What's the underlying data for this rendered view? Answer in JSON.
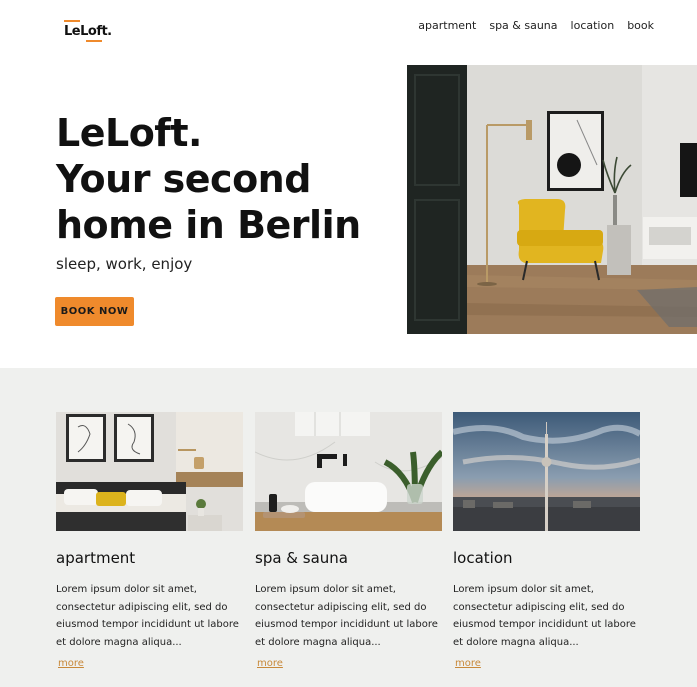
{
  "header": {
    "logo": "LeLoft.",
    "nav": [
      "apartment",
      "spa & sauna",
      "location",
      "book"
    ]
  },
  "hero": {
    "title_lines": [
      "LeLoft.",
      "Your second",
      "home in Berlin"
    ],
    "tagline": "sleep, work, enjoy",
    "cta": "BOOK NOW"
  },
  "cards": [
    {
      "title": "apartment",
      "text": "Lorem ipsum dolor sit amet, consectetur adipiscing elit, sed do eiusmod tempor incididunt ut labore et dolore magna aliqua...",
      "more": "more"
    },
    {
      "title": "spa & sauna",
      "text": "Lorem ipsum dolor sit amet, consectetur adipiscing elit, sed do eiusmod tempor incididunt ut labore et dolore magna aliqua...",
      "more": "more"
    },
    {
      "title": "location",
      "text": "Lorem ipsum dolor sit amet, consectetur adipiscing elit, sed do eiusmod tempor incididunt ut labore et dolore magna aliqua...",
      "more": "more"
    }
  ],
  "colors": {
    "accent": "#ef8a2c",
    "section_bg": "#eff0ee",
    "link": "#c8893a"
  }
}
